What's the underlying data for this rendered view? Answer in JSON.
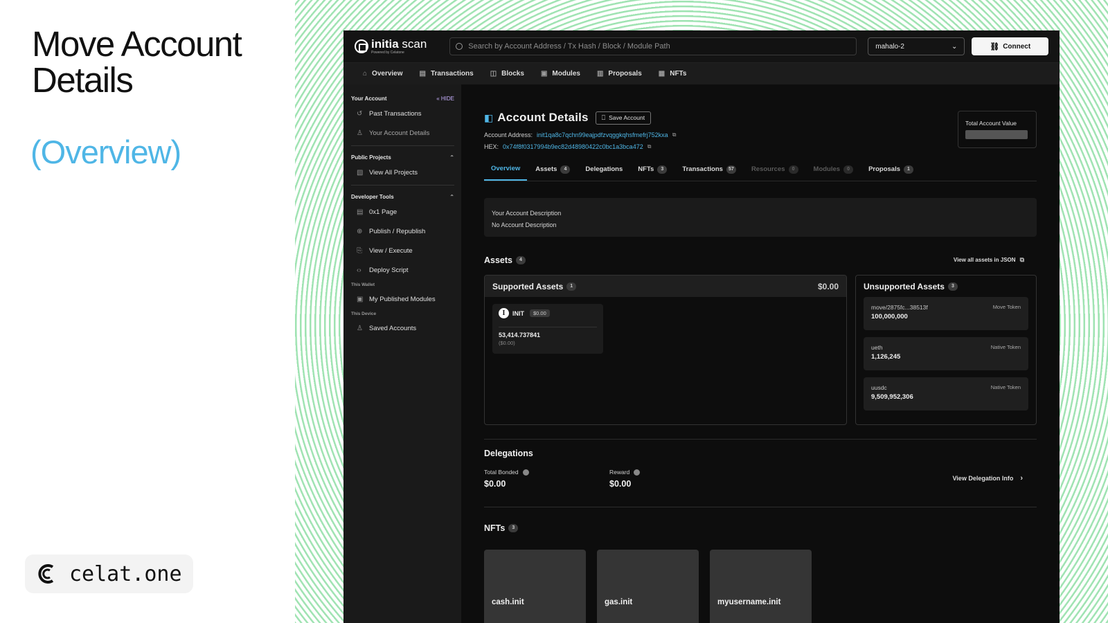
{
  "slide": {
    "title_line1": "Move Account",
    "title_line2": "Details",
    "subtitle": "(Overview)",
    "brand_text": "celat.one"
  },
  "topbar": {
    "logo_bold": "initia",
    "logo_thin": " scan",
    "logo_sub": "Powered by Celatone",
    "search_placeholder": "Search by Account Address / Tx Hash / Block / Module Path",
    "network": "mahalo-2",
    "connect_label": "Connect"
  },
  "nav": [
    {
      "icon": "⌂",
      "label": "Overview"
    },
    {
      "icon": "▤",
      "label": "Transactions"
    },
    {
      "icon": "◫",
      "label": "Blocks"
    },
    {
      "icon": "▣",
      "label": "Modules"
    },
    {
      "icon": "▥",
      "label": "Proposals"
    },
    {
      "icon": "▦",
      "label": "NFTs"
    }
  ],
  "sidebar": {
    "your_account": "Your Account",
    "hide": "HIDE",
    "past_tx": "Past Transactions",
    "account_details": "Your Account Details",
    "public_projects": "Public Projects",
    "view_all_projects": "View All Projects",
    "developer_tools": "Developer Tools",
    "page_0x1": "0x1 Page",
    "publish": "Publish / Republish",
    "view_execute": "View / Execute",
    "deploy_script": "Deploy Script",
    "this_wallet": "This Wallet",
    "my_modules": "My Published Modules",
    "this_device": "This Device",
    "saved_accounts": "Saved Accounts"
  },
  "account": {
    "title": "Account Details",
    "save_label": "Save Account",
    "address_label": "Account Address:",
    "address": "init1qa8c7qchn99eajpdfzvqggkqhsfmefrj752kxa",
    "hex_label": "HEX:",
    "hex": "0x74f8f0317994b9ec82d48980422c0bc1a3bca472",
    "total_label": "Total Account Value"
  },
  "tabs": [
    {
      "label": "Overview",
      "count": ""
    },
    {
      "label": "Assets",
      "count": "4"
    },
    {
      "label": "Delegations",
      "count": ""
    },
    {
      "label": "NFTs",
      "count": "3"
    },
    {
      "label": "Transactions",
      "count": "57"
    },
    {
      "label": "Resources",
      "count": "0"
    },
    {
      "label": "Modules",
      "count": "0"
    },
    {
      "label": "Proposals",
      "count": "1"
    }
  ],
  "description": {
    "label": "Your Account Description",
    "value": "No Account Description"
  },
  "assets": {
    "title": "Assets",
    "count": "4",
    "json_link": "View all assets in JSON",
    "supported_title": "Supported Assets",
    "supported_count": "1",
    "supported_value": "$0.00",
    "token": {
      "symbol": "INIT",
      "price": "$0.00",
      "amount": "53,414.737841",
      "usd": "($0.00)"
    },
    "unsupported_title": "Unsupported Assets",
    "unsupported_count": "3",
    "unsupported": [
      {
        "name": "move/2875fc...38513f",
        "amount": "100,000,000",
        "type": "Move Token"
      },
      {
        "name": "ueth",
        "amount": "1,126,245",
        "type": "Native Token"
      },
      {
        "name": "uusdc",
        "amount": "9,509,952,306",
        "type": "Native Token"
      }
    ]
  },
  "delegations": {
    "title": "Delegations",
    "bonded_label": "Total Bonded",
    "bonded_value": "$0.00",
    "reward_label": "Reward",
    "reward_value": "$0.00",
    "link": "View Delegation Info"
  },
  "nfts": {
    "title": "NFTs",
    "count": "3",
    "items": [
      "cash.init",
      "gas.init",
      "myusername.init"
    ]
  }
}
